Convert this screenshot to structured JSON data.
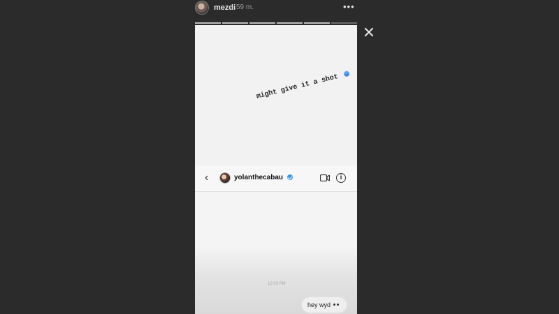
{
  "story": {
    "header": {
      "username": "mezdi",
      "time": "59 m.",
      "more_icon": "more-horizontal-icon",
      "progress_segments": 6
    },
    "caption": {
      "text": "might give it a shot",
      "emoji_icon": "blue-heart-emoji-icon"
    },
    "dm": {
      "header": {
        "back_icon": "chevron-left-icon",
        "username": "yolanthecabau",
        "verified_icon": "verified-badge-icon",
        "video_icon": "video-call-icon",
        "info_icon": "info-icon"
      },
      "timestamp": "12:03 PM",
      "message": "hey wyd"
    }
  },
  "overlay": {
    "close_icon": "close-icon"
  }
}
